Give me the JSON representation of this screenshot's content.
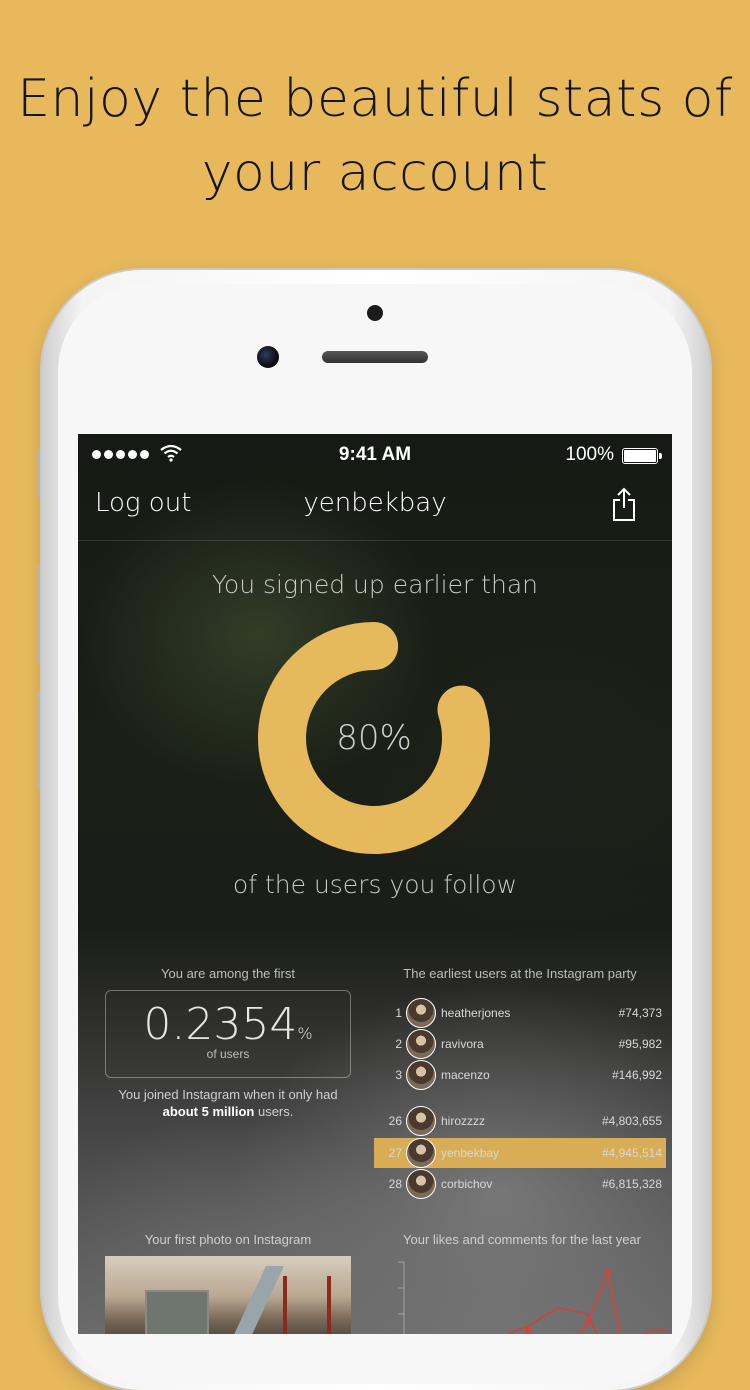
{
  "headline": {
    "line1": "Enjoy the beautiful stats of",
    "line2": "your account"
  },
  "status_bar": {
    "time": "9:41 AM",
    "battery_percent": "100%",
    "battery_level": 1.0,
    "signal_dots": 5
  },
  "navbar": {
    "left_button": "Log out",
    "title": "yenbekbay",
    "right_icon": "share-icon"
  },
  "signup_stat": {
    "top_text": "You signed up earlier than",
    "percent_label": "80%",
    "percent_value": 80,
    "bottom_text": "of the users you follow",
    "ring_color": "#e5b95c"
  },
  "among_first": {
    "title": "You are among the first",
    "value": "0.2354",
    "unit": "%",
    "sub": "of users",
    "joined_prefix": "You joined Instagram when it only had",
    "joined_bold": "about 5 million",
    "joined_suffix": " users."
  },
  "earliest_users": {
    "title": "The earliest users at the Instagram party",
    "rows": [
      {
        "rank": "1",
        "name": "heatherjones",
        "id": "#74,373",
        "highlight": false
      },
      {
        "rank": "2",
        "name": "ravivora",
        "id": "#95,982",
        "highlight": false
      },
      {
        "rank": "3",
        "name": "macenzo",
        "id": "#146,992",
        "highlight": false
      },
      {
        "rank": "26",
        "name": "hirozzzz",
        "id": "#4,803,655",
        "highlight": false
      },
      {
        "rank": "27",
        "name": "yenbekbay",
        "id": "#4,945,514",
        "highlight": true
      },
      {
        "rank": "28",
        "name": "corbichov",
        "id": "#6,815,328",
        "highlight": false
      }
    ]
  },
  "first_photo": {
    "title": "Your first photo on Instagram"
  },
  "likes_comments": {
    "title": "Your likes and comments for the last year",
    "line_color": "#c8443a"
  },
  "colors": {
    "background": "#e7b95c",
    "accent": "#e5b95c",
    "highlight_row": "#d9ad55"
  }
}
